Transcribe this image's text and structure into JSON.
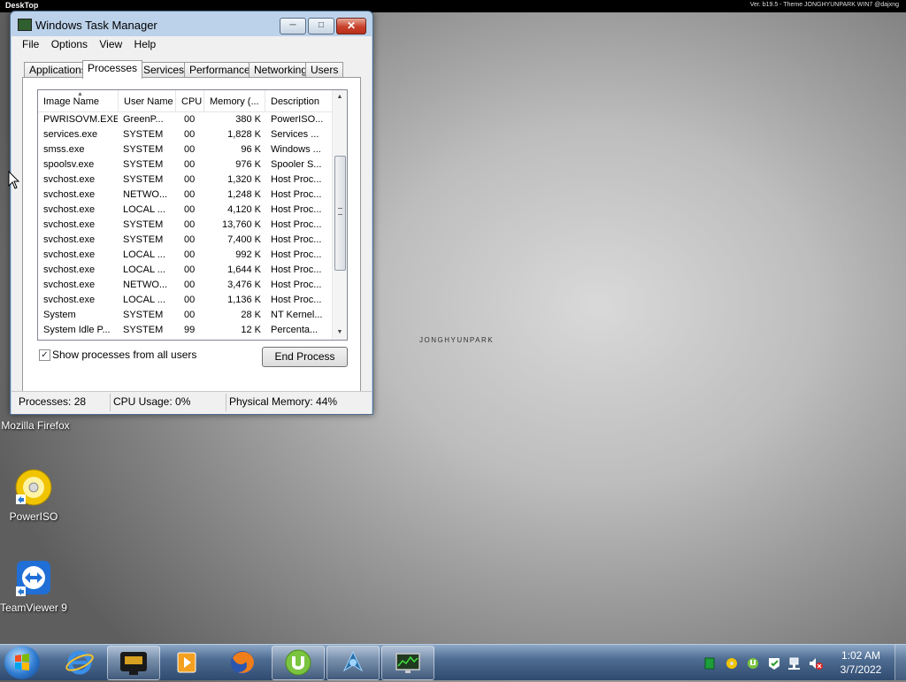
{
  "topbar": {
    "label": "DeskTop",
    "version": "Ver. b19.5 - Theme JONGHYUNPARK WIN7 @dajxng"
  },
  "desktop": {
    "watermark": "JONGHYUNPARK",
    "icons": [
      {
        "label": "Mozilla Firefox",
        "icon": "firefox-icon"
      },
      {
        "label": "PowerISO",
        "icon": "poweriso-icon"
      },
      {
        "label": "TeamViewer 9",
        "icon": "teamviewer-icon"
      }
    ]
  },
  "window": {
    "title": "Windows Task Manager",
    "controls": {
      "minimize": "minimize-icon",
      "maximize": "maximize-icon",
      "close": "close-icon"
    },
    "menu": [
      "File",
      "Options",
      "View",
      "Help"
    ],
    "tabs": [
      "Applications",
      "Processes",
      "Services",
      "Performance",
      "Networking",
      "Users"
    ],
    "active_tab": "Processes",
    "columns": [
      "Image Name",
      "User Name",
      "CPU",
      "Memory (...",
      "Description"
    ],
    "rows": [
      [
        "PWRISOVM.EXE",
        "GreenP...",
        "00",
        "380 K",
        "PowerISO..."
      ],
      [
        "services.exe",
        "SYSTEM",
        "00",
        "1,828 K",
        "Services ..."
      ],
      [
        "smss.exe",
        "SYSTEM",
        "00",
        "96 K",
        "Windows ..."
      ],
      [
        "spoolsv.exe",
        "SYSTEM",
        "00",
        "976 K",
        "Spooler S..."
      ],
      [
        "svchost.exe",
        "SYSTEM",
        "00",
        "1,320 K",
        "Host Proc..."
      ],
      [
        "svchost.exe",
        "NETWO...",
        "00",
        "1,248 K",
        "Host Proc..."
      ],
      [
        "svchost.exe",
        "LOCAL ...",
        "00",
        "4,120 K",
        "Host Proc..."
      ],
      [
        "svchost.exe",
        "SYSTEM",
        "00",
        "13,760 K",
        "Host Proc..."
      ],
      [
        "svchost.exe",
        "SYSTEM",
        "00",
        "7,400 K",
        "Host Proc..."
      ],
      [
        "svchost.exe",
        "LOCAL ...",
        "00",
        "992 K",
        "Host Proc..."
      ],
      [
        "svchost.exe",
        "LOCAL ...",
        "00",
        "1,644 K",
        "Host Proc..."
      ],
      [
        "svchost.exe",
        "NETWO...",
        "00",
        "3,476 K",
        "Host Proc..."
      ],
      [
        "svchost.exe",
        "LOCAL ...",
        "00",
        "1,136 K",
        "Host Proc..."
      ],
      [
        "System",
        "SYSTEM",
        "00",
        "28 K",
        "NT Kernel..."
      ],
      [
        "System Idle P...",
        "SYSTEM",
        "99",
        "12 K",
        "Percenta..."
      ]
    ],
    "show_all_users": {
      "label": "Show processes from all users",
      "checked": true
    },
    "end_process_label": "End Process",
    "status": {
      "processes": "Processes: 28",
      "cpu": "CPU Usage: 0%",
      "memory": "Physical Memory: 44%"
    }
  },
  "taskbar": {
    "start_icon": "windows-start-icon",
    "pinned": [
      "internet-explorer-icon",
      "video-capture-icon",
      "media-player-icon",
      "firefox-icon",
      "utorrent-icon",
      "game-icon",
      "task-manager-icon"
    ],
    "tray_icons": [
      "green-square-icon",
      "poweriso-tray-icon",
      "utorrent-tray-icon",
      "action-center-icon",
      "network-icon",
      "volume-muted-icon"
    ],
    "clock": {
      "time": "1:02 AM",
      "date": "3/7/2022"
    }
  },
  "colors": {
    "titlebar": "#bcd2ea",
    "taskbar": "#4f6d92",
    "close_button": "#c8402a"
  }
}
